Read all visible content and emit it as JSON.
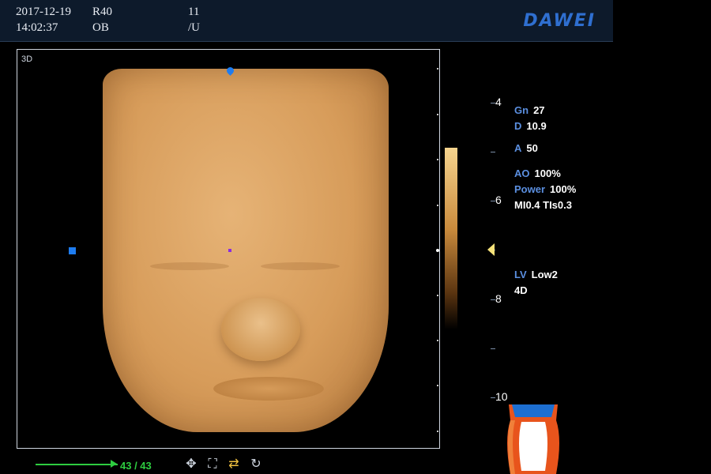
{
  "header": {
    "date": "2017-12-19",
    "probe": "R40",
    "num": "11",
    "time": "14:02:37",
    "app": "OB",
    "unit": "/U",
    "brand": "DAWEI"
  },
  "viewport": {
    "mode": "3D"
  },
  "depth_scale": {
    "labels": [
      "4",
      "6",
      "8",
      "10"
    ]
  },
  "params": {
    "gn": {
      "label": "Gn",
      "value": "27"
    },
    "d": {
      "label": "D",
      "value": "10.9"
    },
    "a": {
      "label": "A",
      "value": "50"
    },
    "ao": {
      "label": "AO",
      "value": "100%"
    },
    "power": {
      "label": "Power",
      "value": "100%"
    },
    "mi_ti": "MI0.4 TIs0.3",
    "lv": {
      "label": "LV",
      "value": "Low2"
    },
    "mode4d": "4D"
  },
  "playback": {
    "frames": "43 / 43",
    "progress": 1.0
  },
  "icons": [
    "move-icon",
    "fit-icon",
    "swap-icon",
    "rotate-icon"
  ],
  "colors": {
    "accent": "#5b8fe0",
    "frame": "#2ecc40",
    "marker": "#f6e27a"
  }
}
